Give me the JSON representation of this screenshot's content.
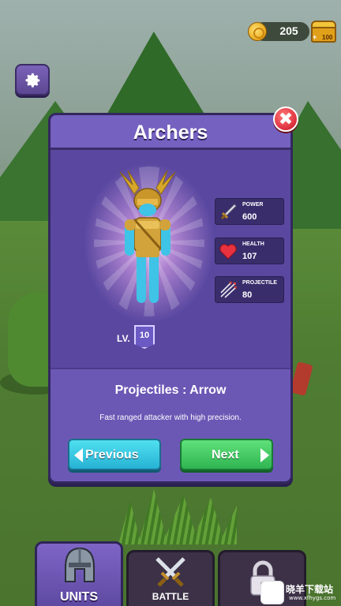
{
  "hud": {
    "coins": "205",
    "chest_badge": "100",
    "chest_plus": "+"
  },
  "panel": {
    "title": "Archers",
    "close_glyph": "✖",
    "level_label": "LV.",
    "level_value": "10",
    "stats": [
      {
        "name": "POWER",
        "value": "600",
        "icon": "sword-icon"
      },
      {
        "name": "HEALTH",
        "value": "107",
        "icon": "heart-icon"
      },
      {
        "name": "PROJECTILE",
        "value": "80",
        "icon": "arrows-icon"
      }
    ],
    "projectiles": "Projectiles : Arrow",
    "description": "Fast ranged attacker with high precision.",
    "previous_label": "Previous",
    "next_label": "Next"
  },
  "tabs": [
    {
      "label": "UNITS",
      "icon": "helmet-icon",
      "active": true
    },
    {
      "label": "BATTLE",
      "icon": "crossed-swords-icon",
      "active": false
    },
    {
      "label": "",
      "icon": "padlock-icon",
      "active": false
    }
  ],
  "watermark": {
    "text": "晓羊下载站",
    "url": "www.xfhygs.com"
  },
  "colors": {
    "panel": "#5a48a0",
    "title_bar": "#7561c0",
    "previous_button": "#27b2d4",
    "next_button": "#2fb552",
    "close_button": "#e0323f"
  }
}
